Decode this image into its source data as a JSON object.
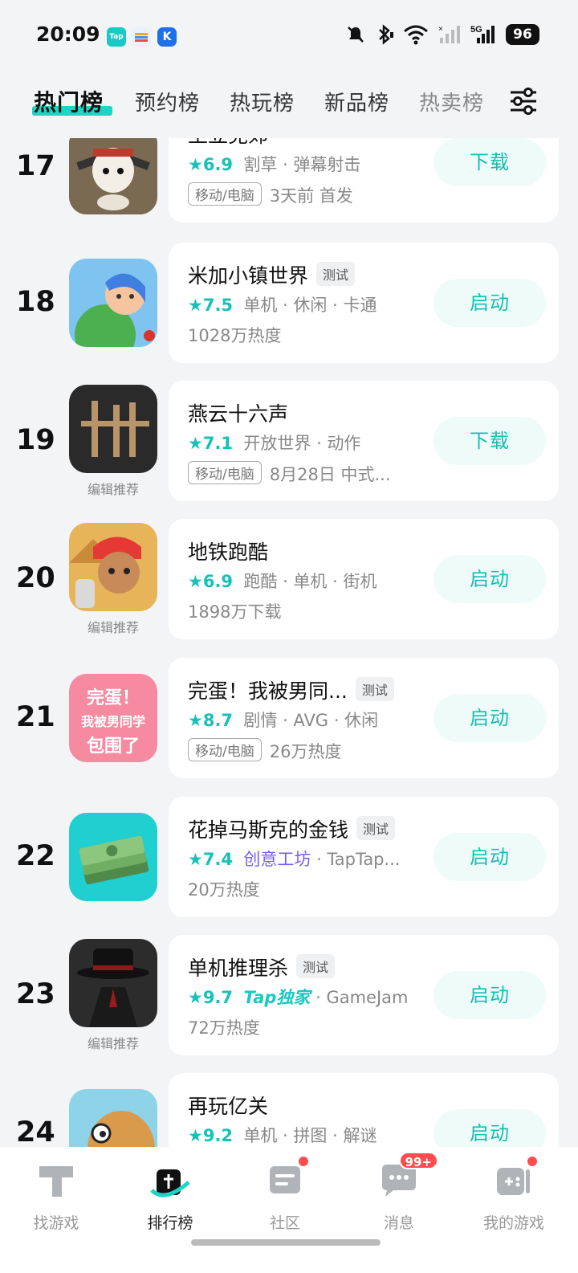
{
  "status_bar": {
    "time": "20:09",
    "app_badges": [
      "Tap",
      "",
      "K"
    ],
    "icons": [
      "mute-icon",
      "bluetooth-icon",
      "wifi-icon",
      "cell-signal-icon",
      "5g-signal-icon"
    ],
    "battery": "96"
  },
  "tabs": [
    {
      "label": "热门榜",
      "active": true
    },
    {
      "label": "预约榜",
      "active": false
    },
    {
      "label": "热玩榜",
      "active": false
    },
    {
      "label": "新品榜",
      "active": false
    },
    {
      "label": "热卖榜",
      "active": false
    }
  ],
  "games": [
    {
      "rank": "17",
      "title": "王立党郊",
      "score": "★6.9",
      "tags": "割草 · 弹幕射击",
      "platform": "移动/电脑",
      "extra": "3天前 首发",
      "action": "下载",
      "test": "",
      "editor_pick": ""
    },
    {
      "rank": "18",
      "title": "米加小镇世界",
      "test": "测试",
      "score": "★7.5",
      "tags": "单机 · 休闲 · 卡通",
      "platform": "",
      "extra": "1028万热度",
      "action": "启动",
      "editor_pick": ""
    },
    {
      "rank": "19",
      "title": "燕云十六声",
      "test": "",
      "score": "★7.1",
      "tags": "开放世界 · 动作",
      "platform": "移动/电脑",
      "extra": "8月28日  中式...",
      "action": "下载",
      "editor_pick": "编辑推荐"
    },
    {
      "rank": "20",
      "title": "地铁跑酷",
      "test": "",
      "score": "★6.9",
      "tags": "跑酷 · 单机 · 街机",
      "platform": "",
      "extra": "1898万下载",
      "action": "启动",
      "editor_pick": "编辑推荐"
    },
    {
      "rank": "21",
      "title": "完蛋！我被男同...",
      "test": "测试",
      "score": "★8.7",
      "tags": "剧情 · AVG · 休闲",
      "platform": "移动/电脑",
      "extra": "26万热度",
      "action": "启动",
      "editor_pick": "",
      "icon_text": [
        "完蛋！",
        "我被男同学",
        "包围了"
      ]
    },
    {
      "rank": "22",
      "title": "花掉马斯克的金钱",
      "test": "测试",
      "score": "★7.4",
      "tag_highlight": "创意工坊",
      "tags": " · TapTap...",
      "platform": "",
      "extra": "20万热度",
      "action": "启动",
      "editor_pick": ""
    },
    {
      "rank": "23",
      "title": "单机推理杀",
      "test": "测试",
      "score": "★9.7",
      "tag_exclusive": "Tap独家",
      "tags": " · GameJam",
      "platform": "",
      "extra": "72万热度",
      "action": "启动",
      "editor_pick": "编辑推荐"
    },
    {
      "rank": "24",
      "title": "再玩亿关",
      "test": "",
      "score": "★9.2",
      "tags": "单机 · 拼图 · 解谜",
      "platform": "",
      "extra": "",
      "action": "启动",
      "editor_pick": ""
    }
  ],
  "bottom_nav": [
    {
      "label": "找游戏",
      "icon": "tap-logo-icon",
      "active": false
    },
    {
      "label": "排行榜",
      "icon": "ranking-icon",
      "active": true
    },
    {
      "label": "社区",
      "icon": "community-icon",
      "active": false,
      "dot": true
    },
    {
      "label": "消息",
      "icon": "message-icon",
      "active": false,
      "count": "99+"
    },
    {
      "label": "我的游戏",
      "icon": "gamepad-icon",
      "active": false,
      "dot": true
    }
  ],
  "colors": {
    "accent": "#16c2b8",
    "background": "#f2f4f6",
    "badge_red": "#ff4d4f"
  }
}
